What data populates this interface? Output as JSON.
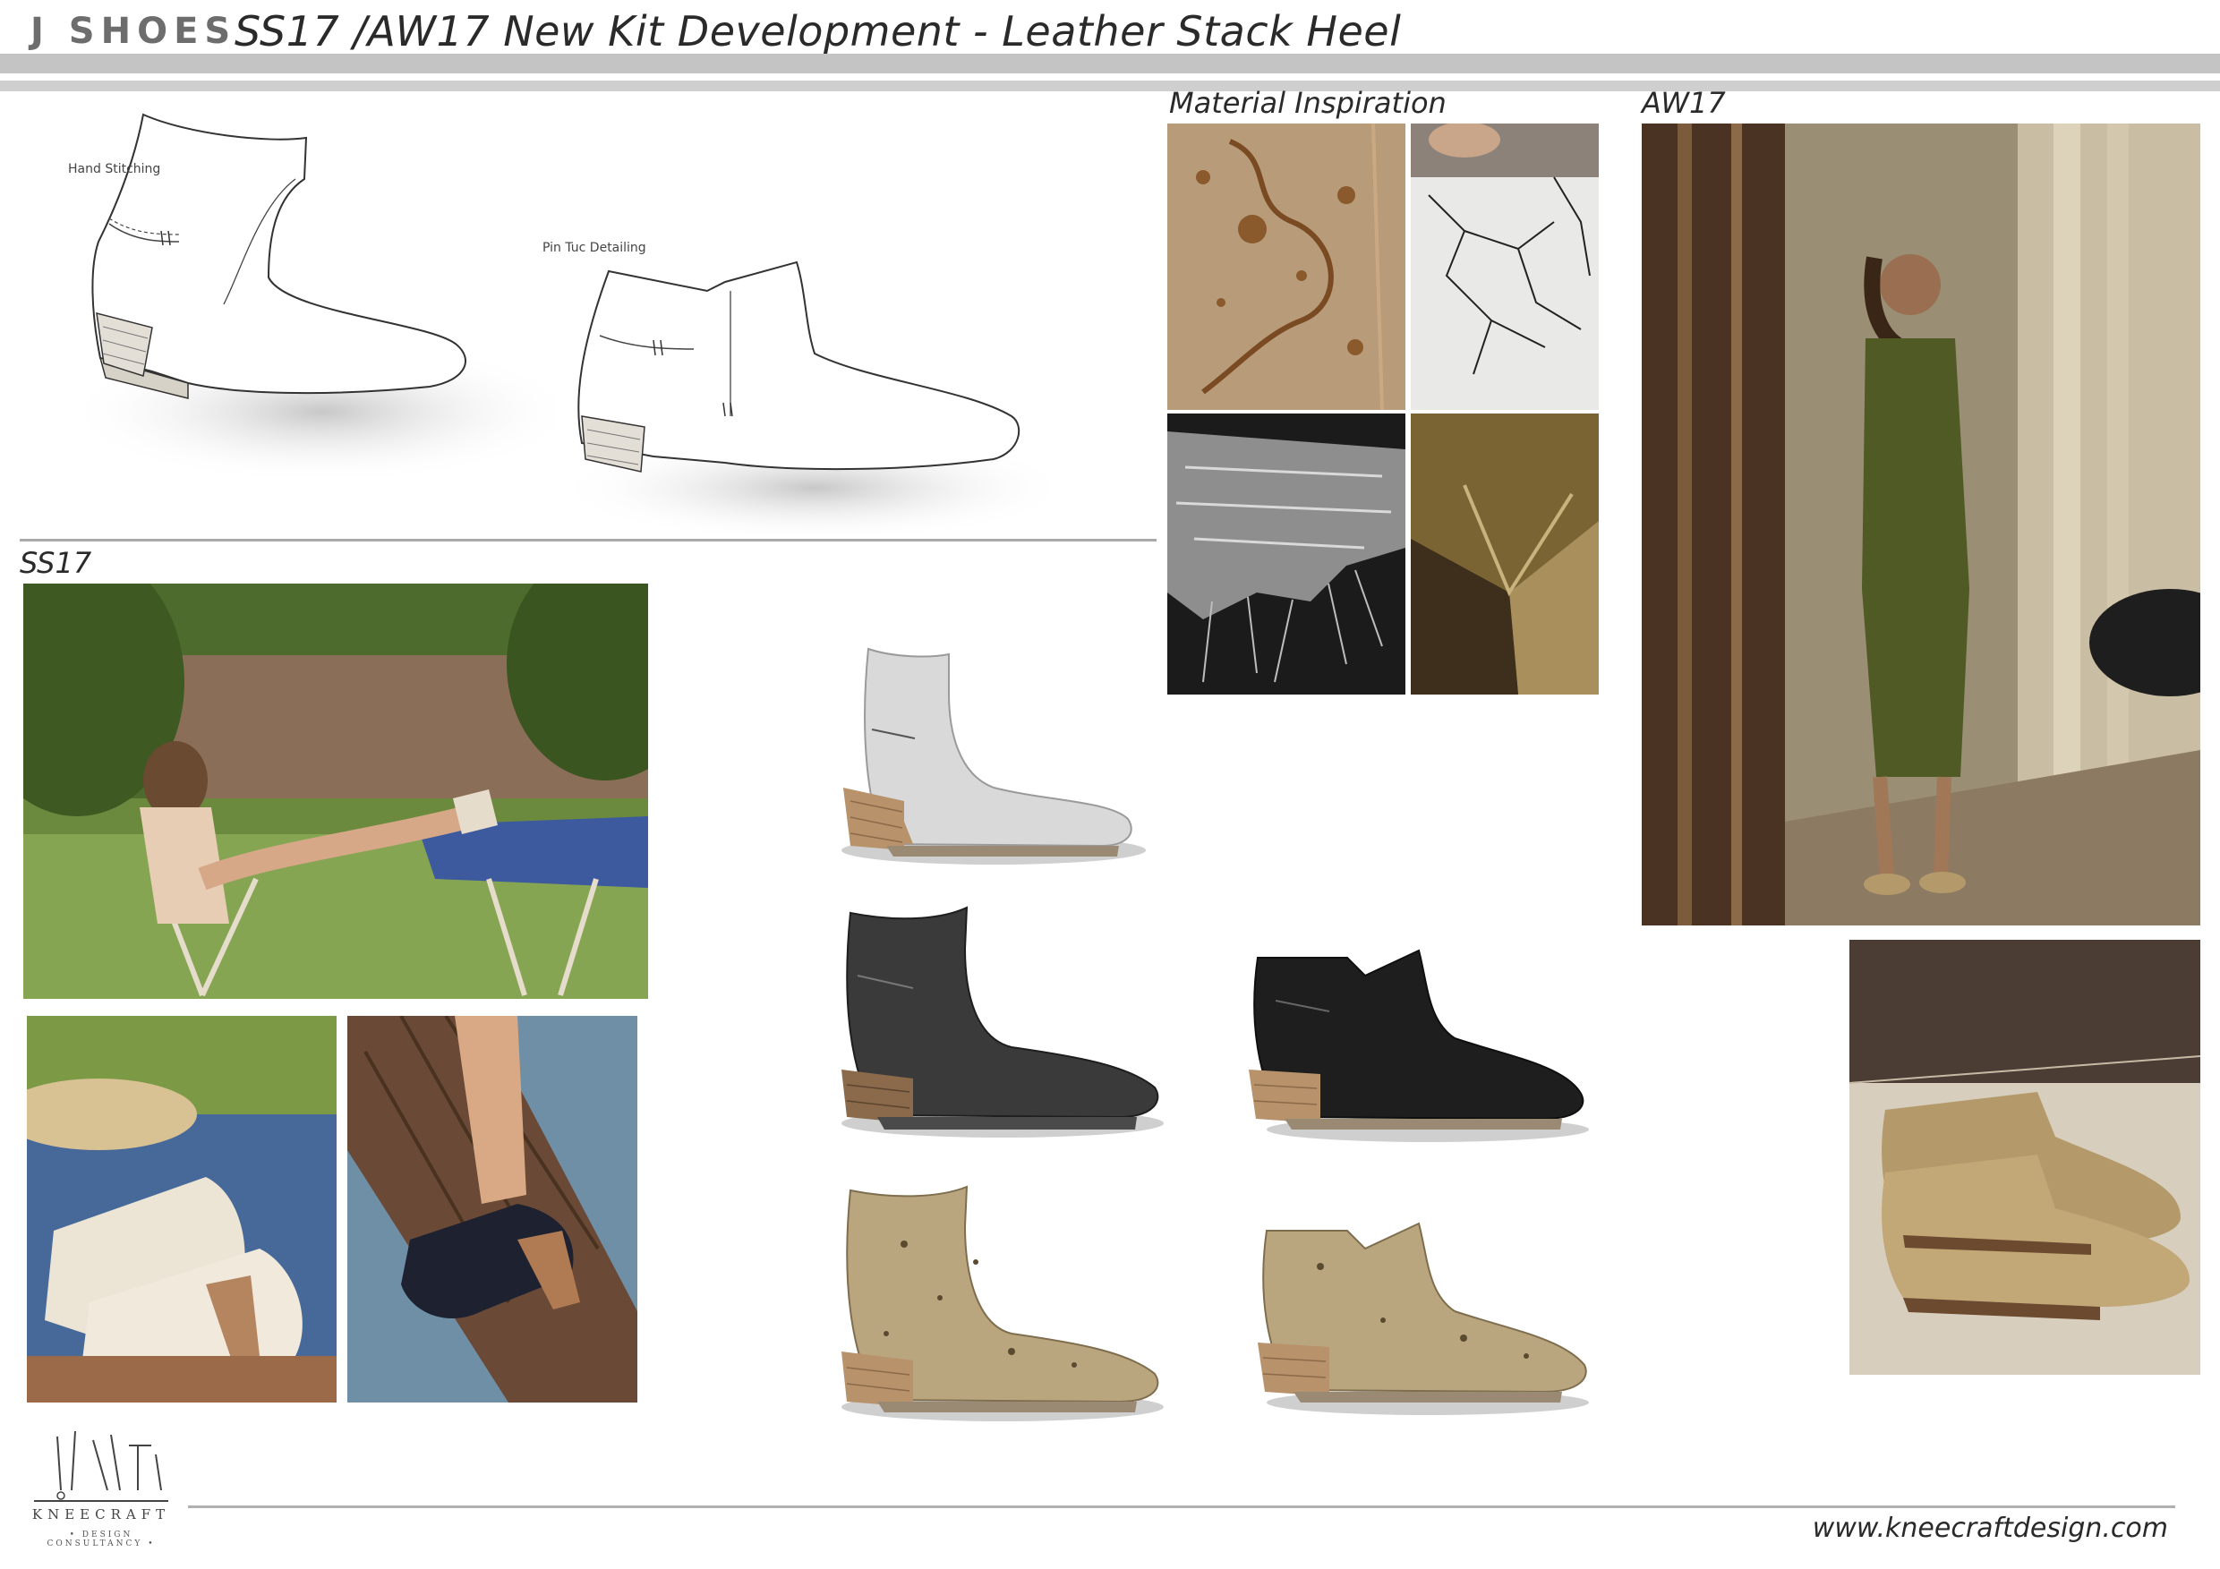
{
  "header": {
    "brand": "J SHOES",
    "title": "SS17 /AW17 New Kit Development - Leather Stack Heel"
  },
  "sketches": {
    "note_hand_stitching": "Hand Stitching",
    "note_pin_tuc": "Pin Tuc Detailing"
  },
  "sections": {
    "material": "Material Inspiration",
    "aw17": "AW17",
    "ss17": "SS17"
  },
  "footer": {
    "logo_name": "KNEECRAFT",
    "logo_tagline": "• DESIGN CONSULTANCY •",
    "website": "www.kneecraftdesign.com"
  },
  "colors": {
    "silver": "#d9d9d9",
    "black_leather": "#3a3a3a",
    "gold_leather": "#b9a57e",
    "heel_wood": "#b8926a",
    "olive_dress": "#4f5a24"
  }
}
